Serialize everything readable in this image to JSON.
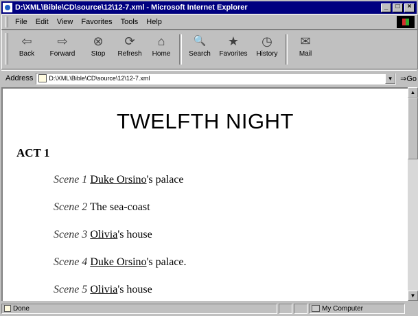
{
  "window": {
    "title": "D:\\XML\\Bible\\CD\\source\\12\\12-7.xml - Microsoft Internet Explorer",
    "caption_buttons": [
      "_",
      "□",
      "×"
    ]
  },
  "menu": {
    "items": [
      "File",
      "Edit",
      "View",
      "Favorites",
      "Tools",
      "Help"
    ]
  },
  "toolbar": {
    "buttons": [
      {
        "label": "Back",
        "icon": "back-arrow-icon",
        "glyph": "⇦"
      },
      {
        "label": "Forward",
        "icon": "forward-arrow-icon",
        "glyph": "⇨"
      },
      {
        "label": "Stop",
        "icon": "stop-icon",
        "glyph": "⊗"
      },
      {
        "label": "Refresh",
        "icon": "refresh-icon",
        "glyph": "⟳"
      },
      {
        "label": "Home",
        "icon": "home-icon",
        "glyph": "⌂"
      },
      {
        "label": "Search",
        "icon": "search-icon",
        "glyph": "🔍"
      },
      {
        "label": "Favorites",
        "icon": "favorites-icon",
        "glyph": "★"
      },
      {
        "label": "History",
        "icon": "history-icon",
        "glyph": "◷"
      },
      {
        "label": "Mail",
        "icon": "mail-icon",
        "glyph": "✉"
      }
    ]
  },
  "address": {
    "label": "Address",
    "url": "D:\\XML\\Bible\\CD\\source\\12\\12-7.xml",
    "go_label": "Go"
  },
  "document": {
    "title": "TWELFTH NIGHT",
    "act": "ACT 1",
    "scenes": [
      {
        "label": "Scene 1",
        "link": "Duke Orsino",
        "rest": "'s palace"
      },
      {
        "label": "Scene 2",
        "link": "",
        "rest": "The sea-coast"
      },
      {
        "label": "Scene 3",
        "link": "Olivia",
        "rest": "'s house"
      },
      {
        "label": "Scene 4",
        "link": "Duke Orsino",
        "rest": "'s palace."
      },
      {
        "label": "Scene 5",
        "link": "Olivia",
        "rest": "'s house"
      }
    ]
  },
  "status": {
    "text": "Done",
    "zone": "My Computer"
  }
}
